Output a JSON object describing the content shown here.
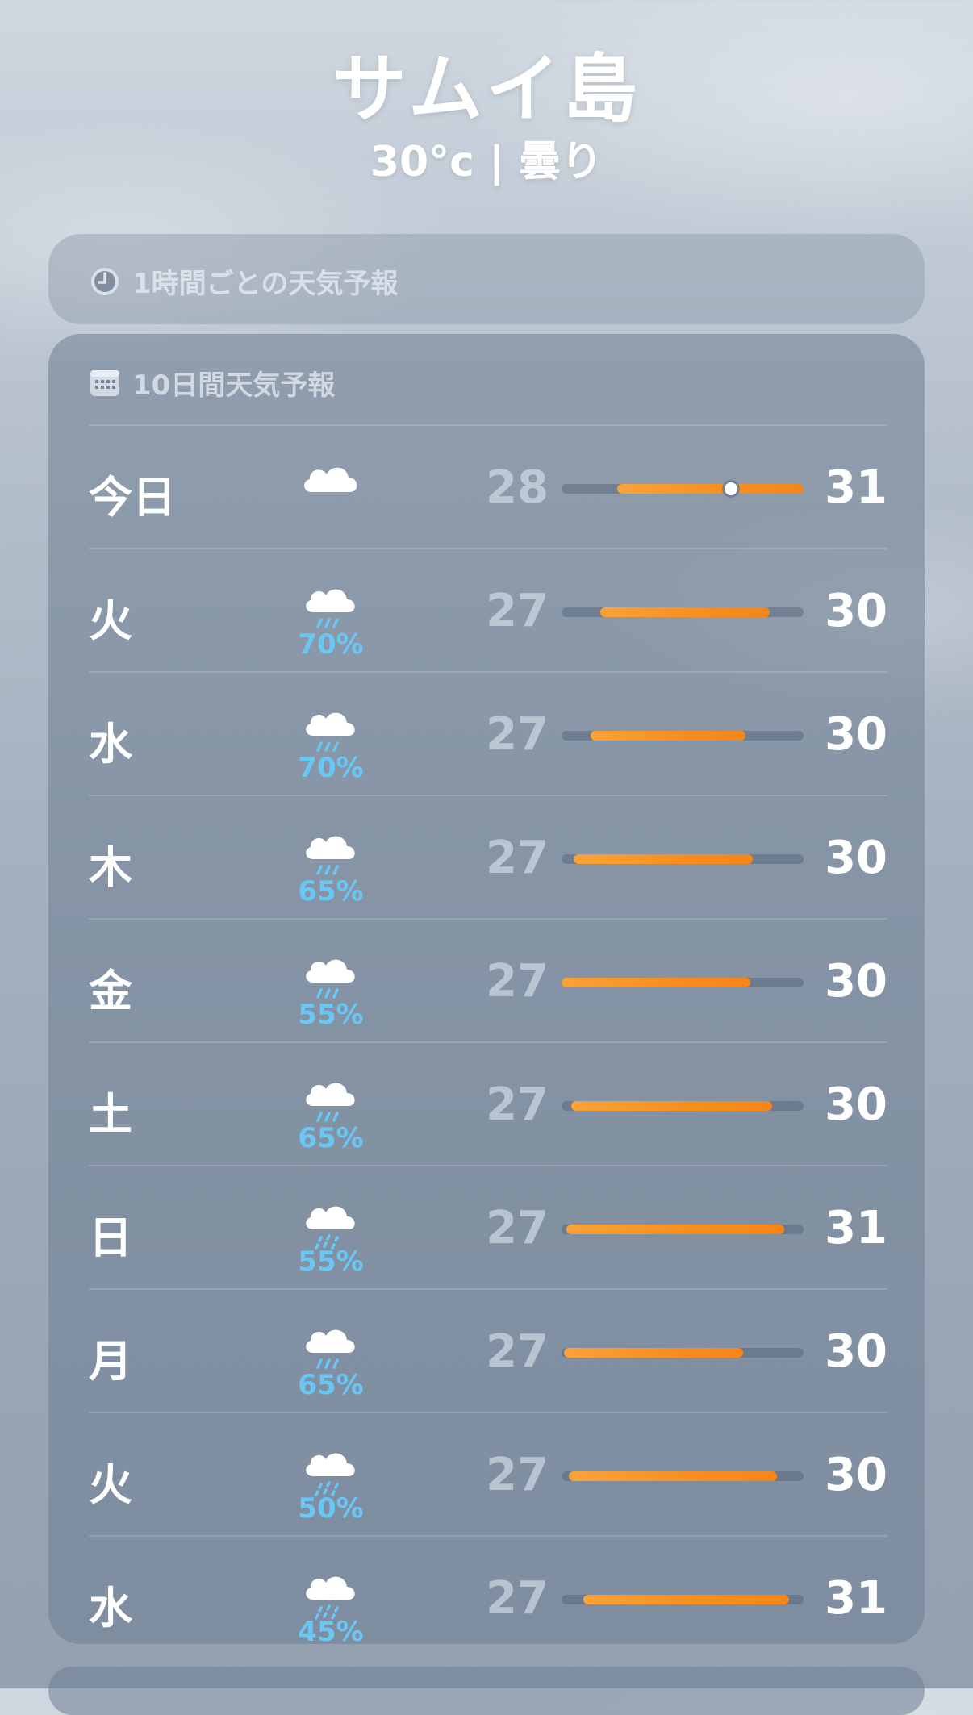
{
  "header": {
    "city": "サムイ島",
    "summary": "30°c | 曇り"
  },
  "hourly": {
    "icon": "clock-icon",
    "title": "1時間ごとの天気予報"
  },
  "forecast": {
    "icon": "calendar-icon",
    "title": "10日間天気予報",
    "rows": [
      {
        "day": "今日",
        "icon": "cloud-icon",
        "precip": "",
        "low": "28",
        "high": "31",
        "range_start": 0.23,
        "range_end": 1.0,
        "current": 0.7
      },
      {
        "day": "火",
        "icon": "cloud-rain-icon",
        "precip": "70%",
        "low": "27",
        "high": "30",
        "range_start": 0.16,
        "range_end": 0.86
      },
      {
        "day": "水",
        "icon": "cloud-rain-icon",
        "precip": "70%",
        "low": "27",
        "high": "30",
        "range_start": 0.12,
        "range_end": 0.76
      },
      {
        "day": "木",
        "icon": "cloud-rain-icon",
        "precip": "65%",
        "low": "27",
        "high": "30",
        "range_start": 0.05,
        "range_end": 0.79
      },
      {
        "day": "金",
        "icon": "cloud-rain-icon",
        "precip": "55%",
        "low": "27",
        "high": "30",
        "range_start": 0.0,
        "range_end": 0.78
      },
      {
        "day": "土",
        "icon": "cloud-rain-icon",
        "precip": "65%",
        "low": "27",
        "high": "30",
        "range_start": 0.04,
        "range_end": 0.87
      },
      {
        "day": "日",
        "icon": "cloud-drizzle-icon",
        "precip": "55%",
        "low": "27",
        "high": "31",
        "range_start": 0.02,
        "range_end": 0.92
      },
      {
        "day": "月",
        "icon": "cloud-rain-icon",
        "precip": "65%",
        "low": "27",
        "high": "30",
        "range_start": 0.01,
        "range_end": 0.75
      },
      {
        "day": "火",
        "icon": "cloud-drizzle-icon",
        "precip": "50%",
        "low": "27",
        "high": "30",
        "range_start": 0.03,
        "range_end": 0.89
      },
      {
        "day": "水",
        "icon": "cloud-drizzle-icon",
        "precip": "45%",
        "low": "27",
        "high": "31",
        "range_start": 0.09,
        "range_end": 0.94
      }
    ]
  },
  "colors": {
    "bar_orange": "#f78e1e",
    "precip_blue": "#69c7f5"
  }
}
